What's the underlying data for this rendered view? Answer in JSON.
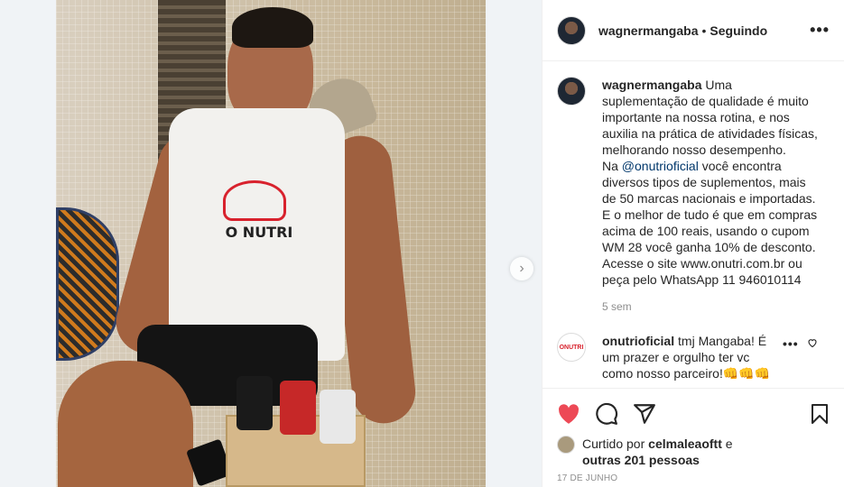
{
  "post": {
    "username": "wagnermangaba",
    "dot": "•",
    "follow_status": "Seguindo",
    "more_icon": "more-horizontal-icon",
    "photo_text": "O NUTRI"
  },
  "caption": {
    "username": "wagnermangaba",
    "text_1": " Uma suplementação de qualidade é muito importante na nossa rotina, e nos auxilia na prática de atividades físicas, melhorando nosso desempenho.",
    "text_2a": "Na ",
    "mention": "@onutrioficial",
    "text_2b": " você encontra diversos tipos de suplementos, mais de 50 marcas nacionais e importadas.",
    "text_3": "E o melhor de tudo é que em compras acima de 100 reais, usando o cupom WM 28 você ganha 10% de desconto.",
    "text_4": "Acesse o site www.onutri.com.br ou peça pelo WhatsApp 11 946010114",
    "timestamp": "5 sem"
  },
  "comment": {
    "username": "onutrioficial",
    "avatar_text": "ONUTRI",
    "text": " tmj Mangaba! É um prazer e orgulho ter vc como nosso parceiro!👊👊👊",
    "more": "•••"
  },
  "actions": {
    "liked_by_prefix": "Curtido por ",
    "liked_by_user": "celmaleaoftt",
    "liked_by_and": " e",
    "others": "outras 201 pessoas",
    "date": "17 DE JUNHO",
    "like_color": "#ed4956"
  },
  "nav": {
    "next_label": "›"
  }
}
